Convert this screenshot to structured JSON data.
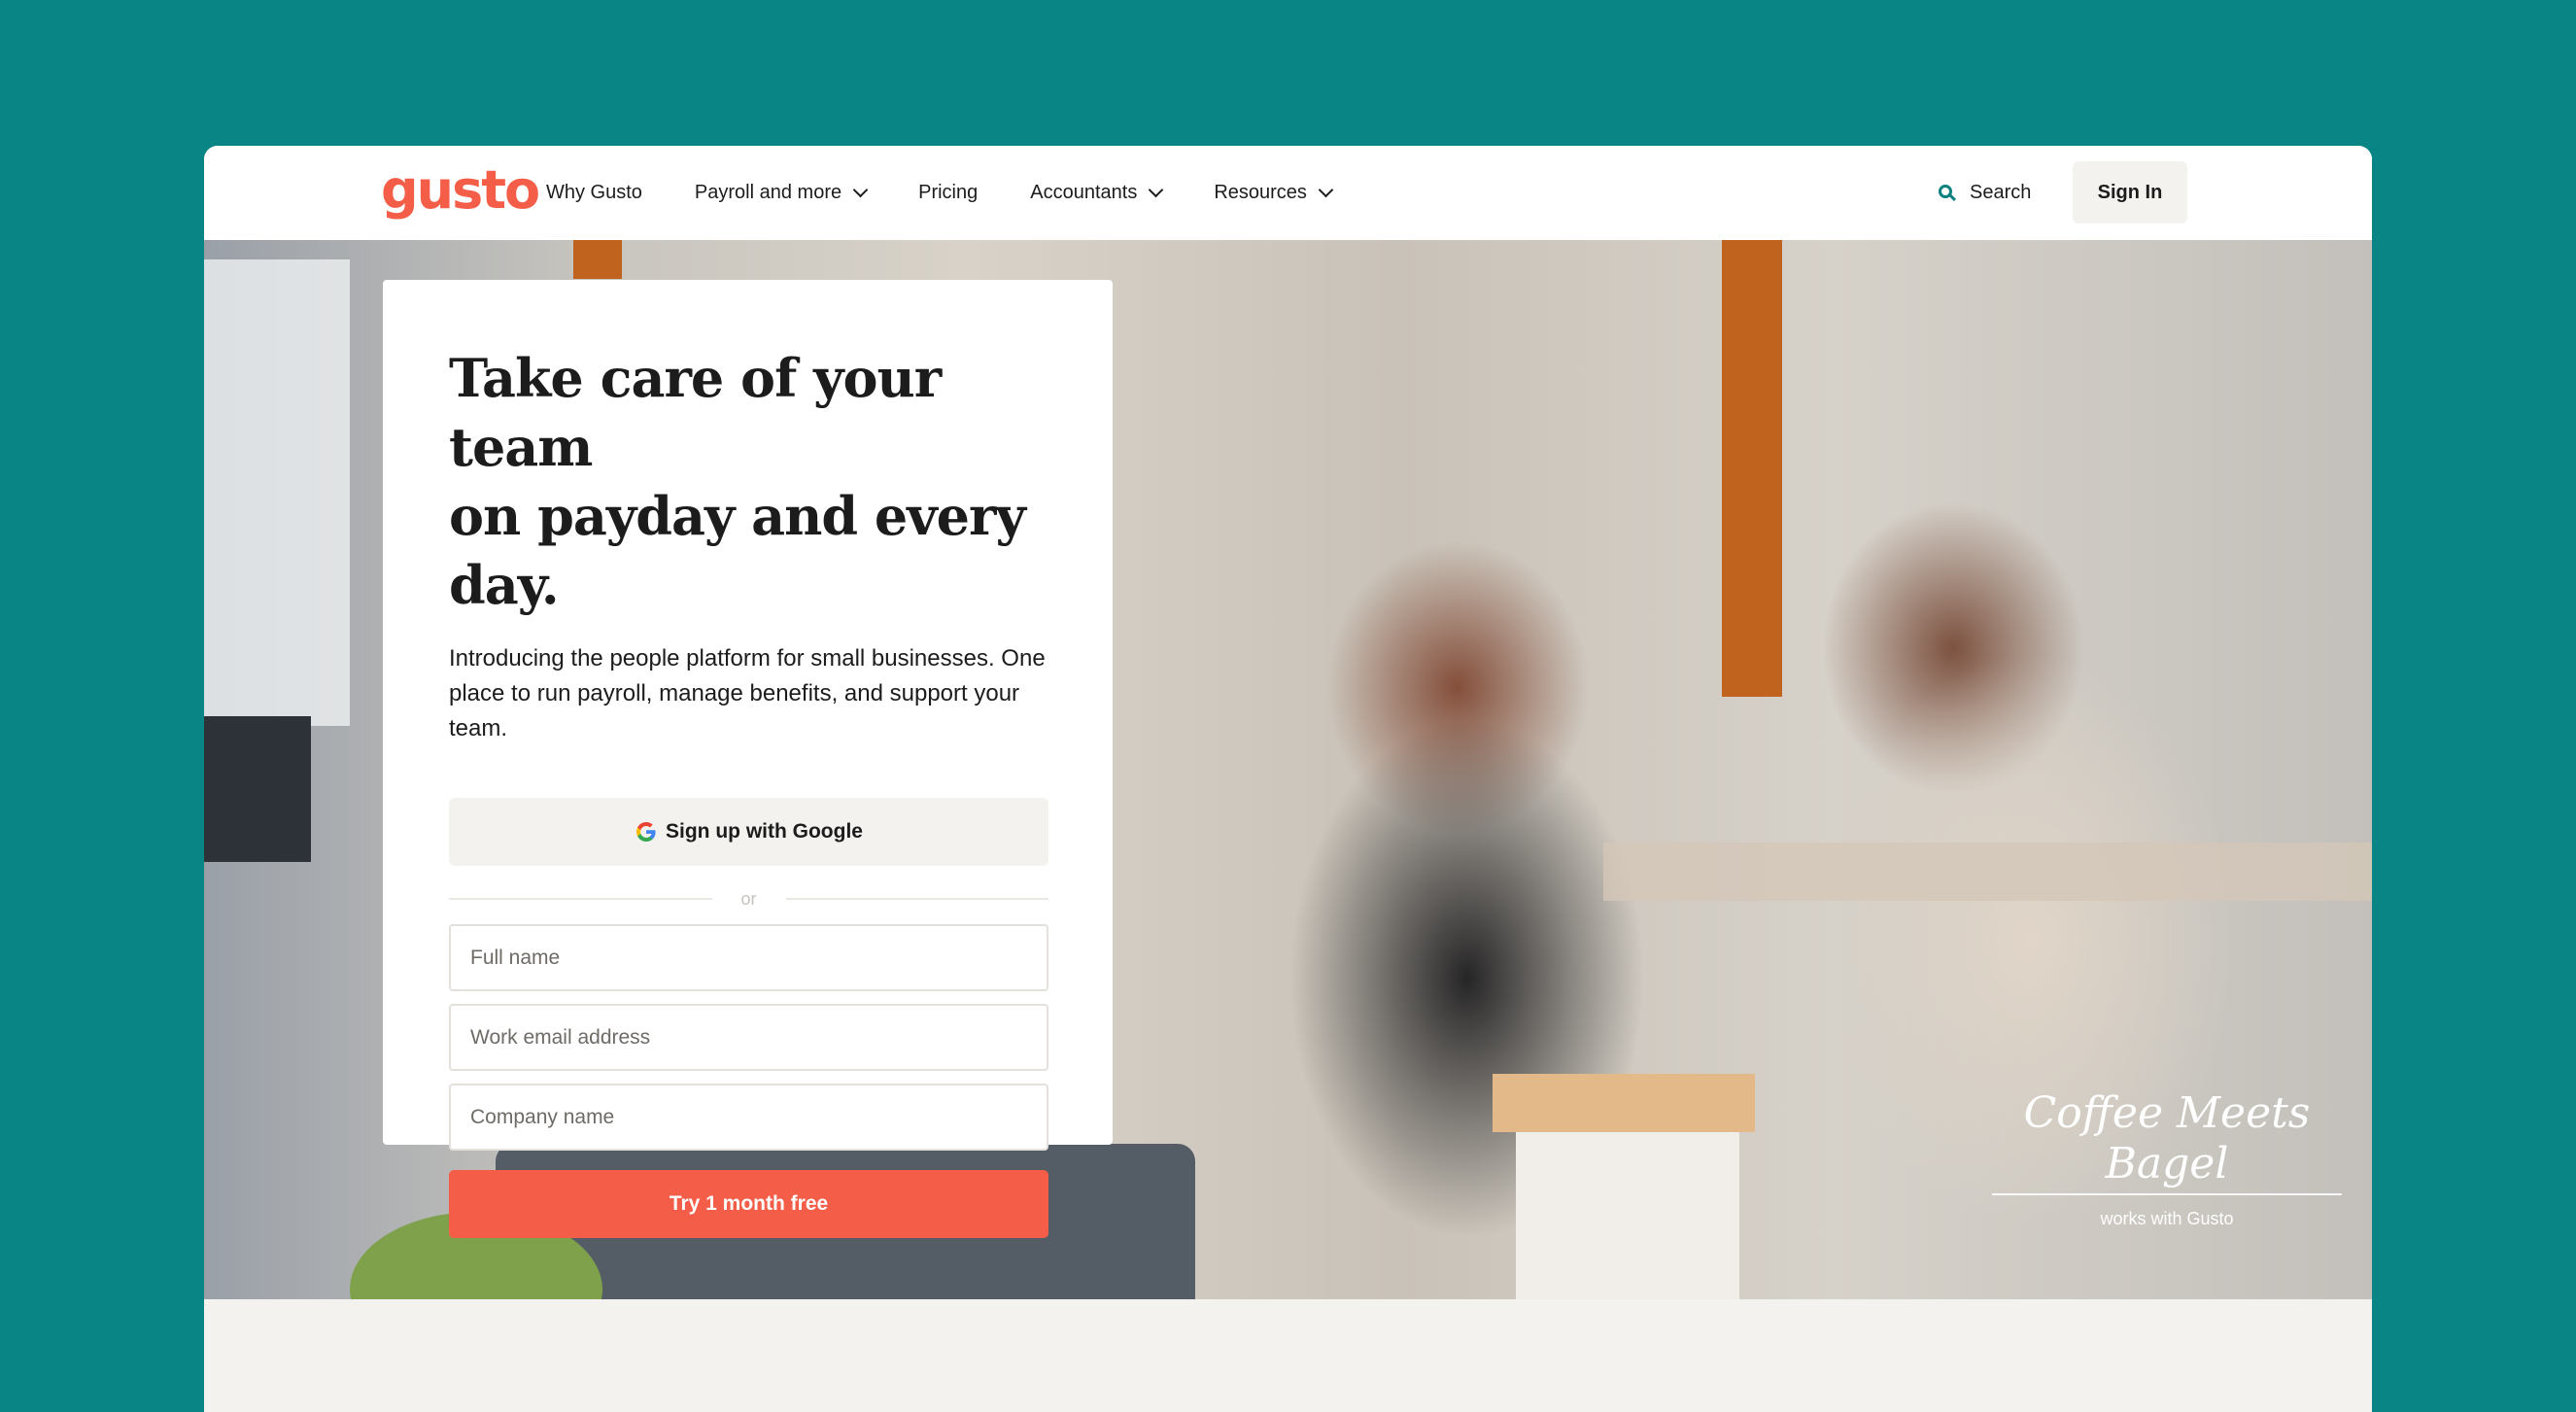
{
  "nav": {
    "logo": "gusto",
    "items": [
      {
        "label": "Why Gusto",
        "dropdown": false
      },
      {
        "label": "Payroll and more",
        "dropdown": true
      },
      {
        "label": "Pricing",
        "dropdown": false
      },
      {
        "label": "Accountants",
        "dropdown": true
      },
      {
        "label": "Resources",
        "dropdown": true
      }
    ],
    "search_label": "Search",
    "signin_label": "Sign In"
  },
  "signup": {
    "headline_line1": "Take care of your team",
    "headline_line2": "on payday and every day.",
    "subtitle": "Introducing the people platform for small businesses. One place to run payroll, manage benefits, and support your team.",
    "google_button": "Sign up with Google",
    "divider_text": "or",
    "full_name_placeholder": "Full name",
    "email_placeholder": "Work email address",
    "company_placeholder": "Company name",
    "cta_label": "Try 1 month free"
  },
  "customer": {
    "logo_text": "Coffee Meets Bagel",
    "caption": "works with Gusto"
  },
  "colors": {
    "background": "#0a8585",
    "brand": "#f45d48",
    "search_icon": "#0a8080"
  }
}
